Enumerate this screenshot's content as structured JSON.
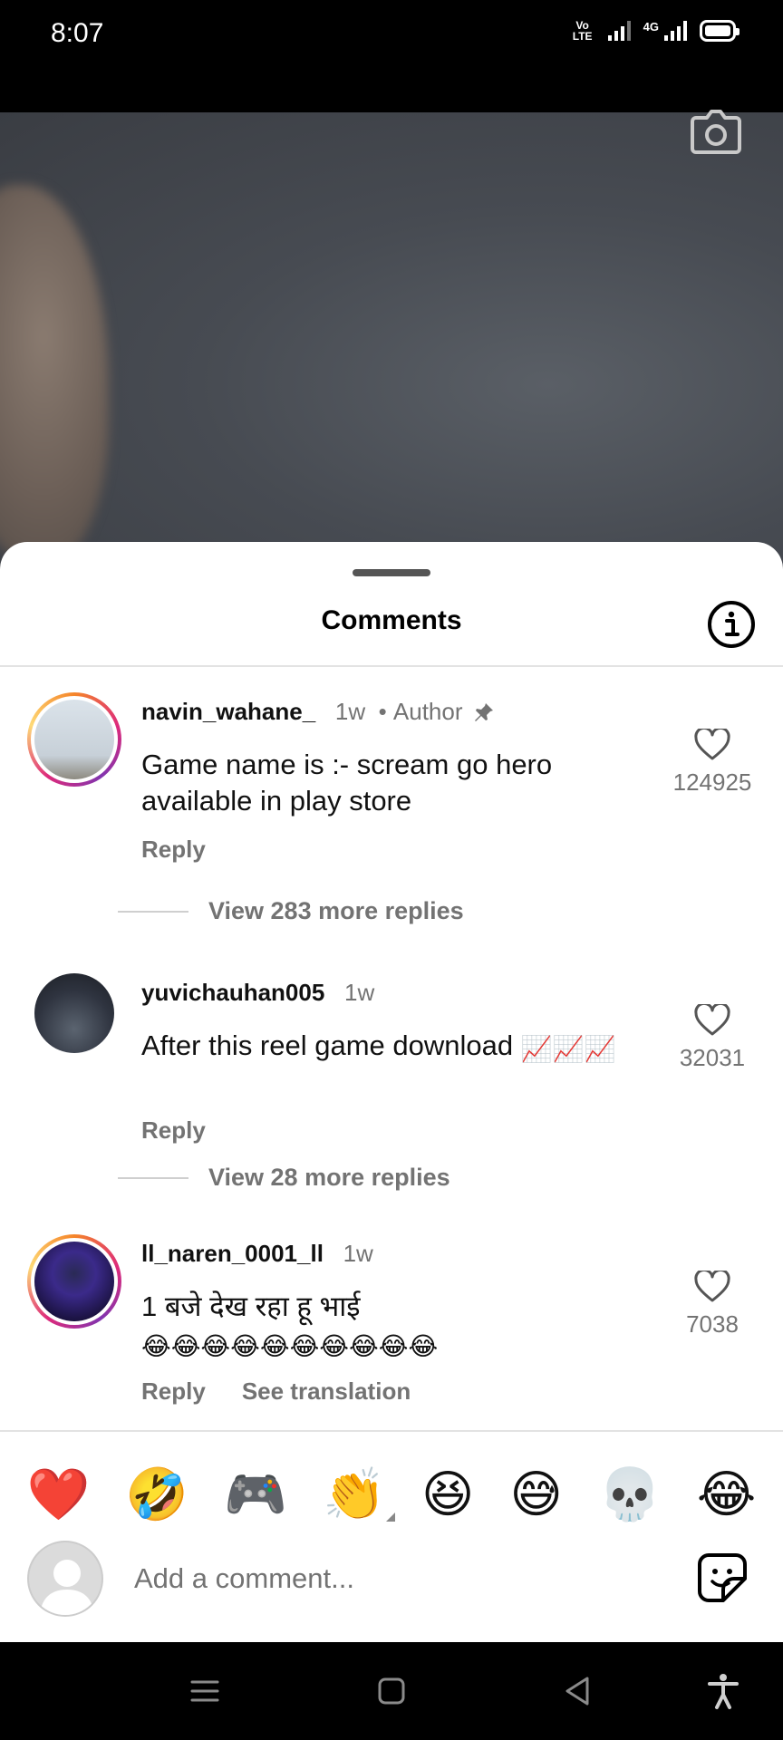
{
  "status_bar": {
    "time": "8:07",
    "volte_label": "Vo LTE",
    "network_label": "4G"
  },
  "sheet": {
    "title": "Comments"
  },
  "comments": [
    {
      "username": "navin_wahane_",
      "age": "1w",
      "badge": "Author",
      "text": "Game name is :- scream go hero available in play store",
      "reply_label": "Reply",
      "likes": "124925",
      "view_replies": "View 283 more replies"
    },
    {
      "username": "yuvichauhan005",
      "age": "1w",
      "text": "After this reel game download",
      "emoji_suffix": "📈📈📈",
      "reply_label": "Reply",
      "likes": "32031",
      "view_replies": "View 28 more replies"
    },
    {
      "username": "ll_naren_0001_ll",
      "age": "1w",
      "text": "1 बजे देख रहा हू भाई",
      "emoji_suffix": "😂😂😂😂😂😂😂😂😂😂",
      "reply_label": "Reply",
      "translate_label": "See translation",
      "likes": "7038"
    }
  ],
  "emoji_bar": [
    "❤️",
    "🤣",
    "🎮",
    "👏",
    "😆",
    "😅",
    "💀",
    "😂"
  ],
  "composer": {
    "placeholder": "Add a comment..."
  },
  "icons": {
    "camera": "camera-icon",
    "info": "info-icon",
    "heart": "heart-outline-icon",
    "pin": "pin-icon",
    "sticker": "sticker-icon",
    "nav_menu": "menu-icon",
    "nav_home": "home-square-icon",
    "nav_back": "back-triangle-icon",
    "nav_accessibility": "accessibility-icon"
  }
}
